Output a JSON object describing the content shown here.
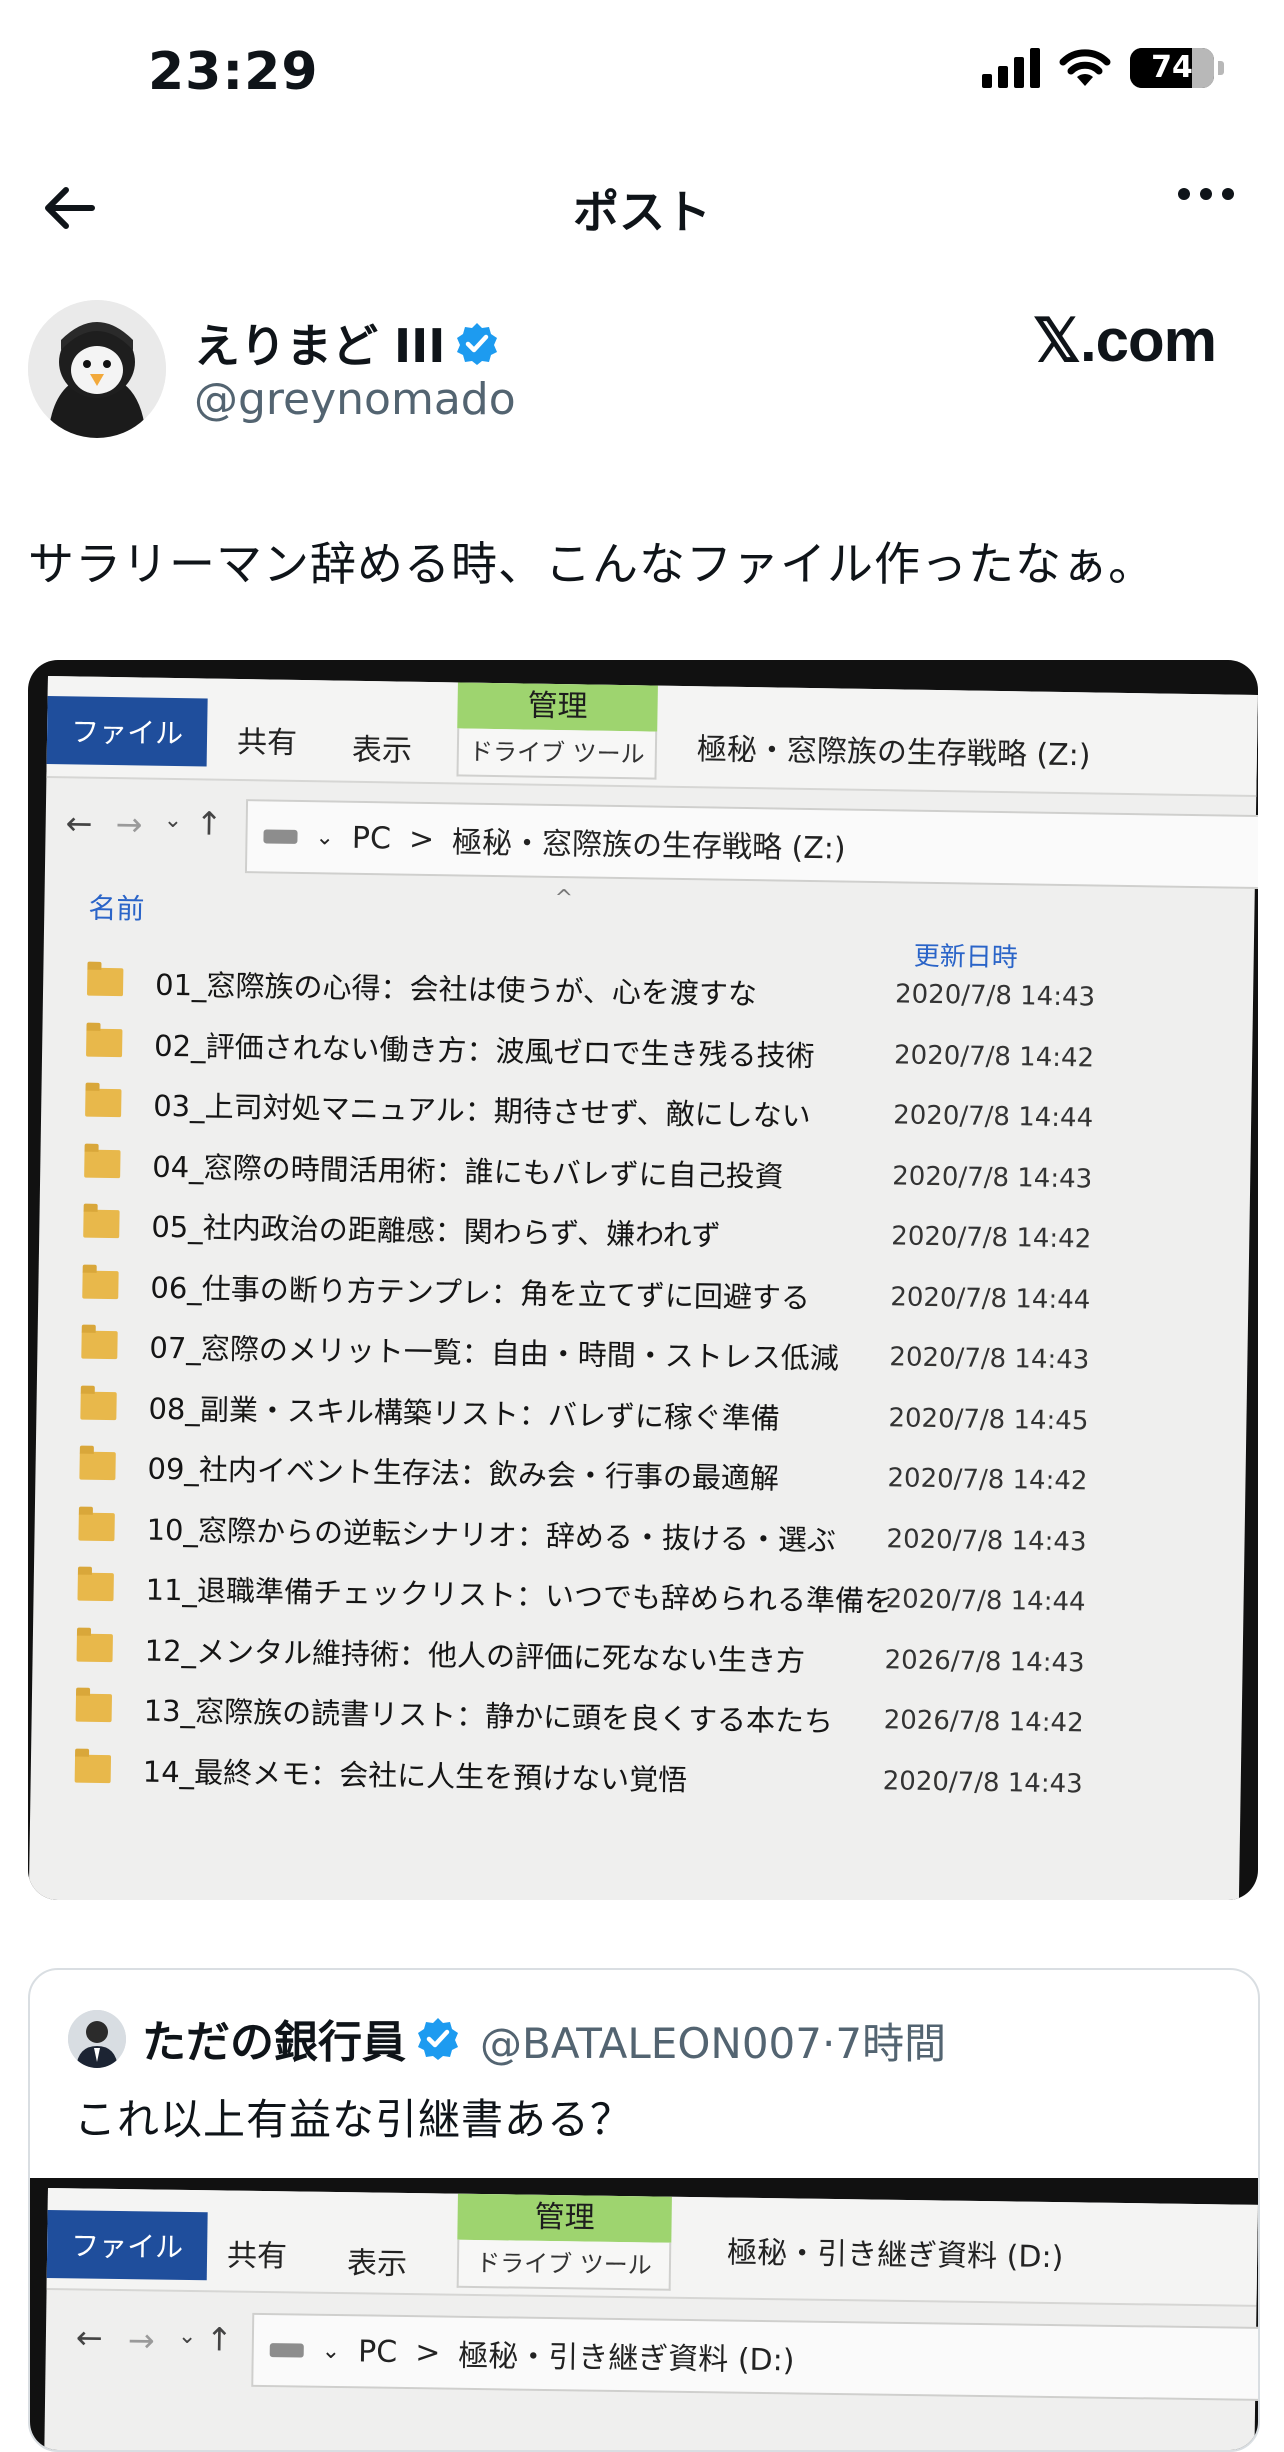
{
  "status_bar": {
    "time": "23:29",
    "battery": "74",
    "battery_level_percent": 74
  },
  "header": {
    "title": "ポスト"
  },
  "author": {
    "name": "えりまど III",
    "handle": "@greynomado",
    "verified": true
  },
  "brand": {
    "logo_text": "𝕏.com"
  },
  "post": {
    "text": "サラリーマン辞める時、こんなファイル作ったなぁ。"
  },
  "explorer_main": {
    "tab_file": "ファイル",
    "tab_share": "共有",
    "tab_view": "表示",
    "tab_manage": "管理",
    "tab_drive_tools": "ドライブ ツール",
    "window_title": "極秘・窓際族の生存戦略 (Z:)",
    "address_pc": "PC",
    "address_sep": ">",
    "address_drive": "極秘・窓際族の生存戦略 (Z:)",
    "col_name": "名前",
    "col_date": "更新日時",
    "rows": [
      {
        "name": "01_窓際族の心得：会社は使うが、心を渡すな",
        "date": "2020/7/8 14:43"
      },
      {
        "name": "02_評価されない働き方：波風ゼロで生き残る技術",
        "date": "2020/7/8 14:42"
      },
      {
        "name": "03_上司対処マニュアル：期待させず、敵にしない",
        "date": "2020/7/8 14:44"
      },
      {
        "name": "04_窓際の時間活用術：誰にもバレずに自己投資",
        "date": "2020/7/8 14:43"
      },
      {
        "name": "05_社内政治の距離感：関わらず、嫌われず",
        "date": "2020/7/8 14:42"
      },
      {
        "name": "06_仕事の断り方テンプレ：角を立てずに回避する",
        "date": "2020/7/8 14:44"
      },
      {
        "name": "07_窓際のメリット一覧：自由・時間・ストレス低減",
        "date": "2020/7/8 14:43"
      },
      {
        "name": "08_副業・スキル構築リスト：バレずに稼ぐ準備",
        "date": "2020/7/8 14:45"
      },
      {
        "name": "09_社内イベント生存法：飲み会・行事の最適解",
        "date": "2020/7/8 14:42"
      },
      {
        "name": "10_窓際からの逆転シナリオ：辞める・抜ける・選ぶ",
        "date": "2020/7/8 14:43"
      },
      {
        "name": "11_退職準備チェックリスト：いつでも辞められる準備を",
        "date": "2020/7/8 14:44"
      },
      {
        "name": "12_メンタル維持術：他人の評価に死なない生き方",
        "date": "2026/7/8 14:43"
      },
      {
        "name": "13_窓際族の読書リスト：静かに頭を良くする本たち",
        "date": "2026/7/8 14:42"
      },
      {
        "name": "14_最終メモ：会社に人生を預けない覚悟",
        "date": "2020/7/8 14:43"
      }
    ]
  },
  "quote": {
    "name": "ただの銀行員",
    "handle": "@BATALEON007",
    "separator": "·",
    "time": "7時間",
    "verified": true,
    "text": "これ以上有益な引継書ある？",
    "explorer": {
      "tab_file": "ファイル",
      "tab_share": "共有",
      "tab_view": "表示",
      "tab_manage": "管理",
      "tab_drive_tools": "ドライブ ツール",
      "window_title": "極秘・引き継ぎ資料 (D:)",
      "address_pc": "PC",
      "address_sep": ">",
      "address_drive": "極秘・引き継ぎ資料 (D:)"
    }
  },
  "colors": {
    "verified_blue": "#1d9bf0",
    "file_tab_blue": "#1f4e9c",
    "manage_green": "#9ed46f",
    "folder_yellow": "#e8b84b",
    "handle_gray": "#536471"
  }
}
